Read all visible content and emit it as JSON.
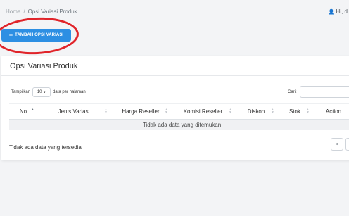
{
  "breadcrumb": {
    "home": "Home",
    "separator": "/",
    "current": "Opsi Variasi Produk"
  },
  "user": {
    "greeting": "Hi, d",
    "icon": "user-icon"
  },
  "actions": {
    "add_label": "TAMBAH OPSI VARIASI",
    "add_icon": "plus-icon",
    "add_color": "#2d8fe3"
  },
  "annotation": {
    "color": "#e0242a"
  },
  "card": {
    "title": "Opsi Variasi Produk",
    "length": {
      "prefix": "Tampilkan",
      "value": "10",
      "suffix": "data per halaman"
    },
    "search": {
      "label": "Cari:",
      "value": ""
    },
    "table": {
      "columns": [
        "No",
        "Jenis Variasi",
        "Harga Reseller",
        "Komisi Reseller",
        "Diskon",
        "Stok",
        "Action"
      ],
      "empty_message": "Tidak ada data yang ditemukan"
    },
    "info": "Tidak ada data yang tersedia",
    "pager": {
      "prev": "<",
      "next": ">"
    }
  }
}
